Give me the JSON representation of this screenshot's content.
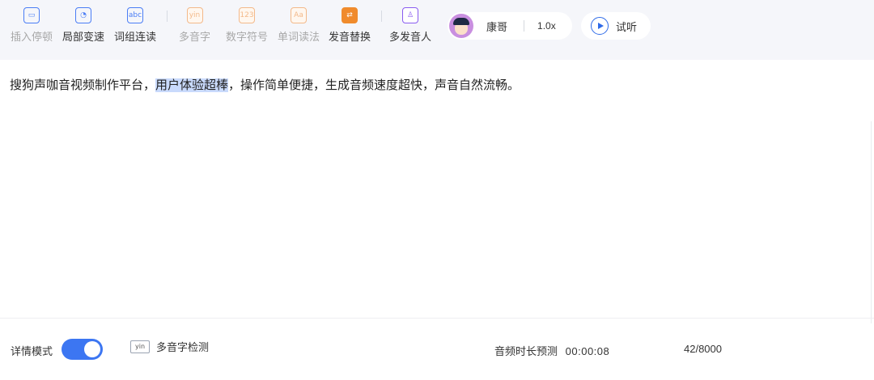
{
  "toolbar": {
    "tools": [
      {
        "label": "插入停顿",
        "glyph": "▭"
      },
      {
        "label": "局部变速",
        "glyph": "◔"
      },
      {
        "label": "词组连读",
        "glyph": "abc"
      },
      {
        "label": "多音字",
        "glyph": "yin"
      },
      {
        "label": "数字符号",
        "glyph": "123"
      },
      {
        "label": "单词读法",
        "glyph": "Aa"
      },
      {
        "label": "发音替换",
        "glyph": "⇄"
      },
      {
        "label": "多发音人",
        "glyph": "♙"
      }
    ],
    "speaker": {
      "name": "康哥",
      "speed": "1.0x"
    },
    "listen_label": "试听"
  },
  "editor": {
    "text_before": "搜狗声咖音视频制作平台，",
    "text_highlight": "用户体验超棒",
    "text_after": "，操作简单便捷，生成音频速度超快，声音自然流畅。"
  },
  "footer": {
    "detail_mode_label": "详情模式",
    "detail_mode_on": true,
    "polyphone_icon_text": "yin",
    "polyphone_check_label": "多音字检测",
    "duration_label": "音频时长预测",
    "duration_value": "00:00:08",
    "char_count": "42/8000"
  },
  "colors": {
    "accent": "#3c76f2",
    "highlight": "#c9dafc",
    "toolbar_bg": "#f5f6fa"
  }
}
